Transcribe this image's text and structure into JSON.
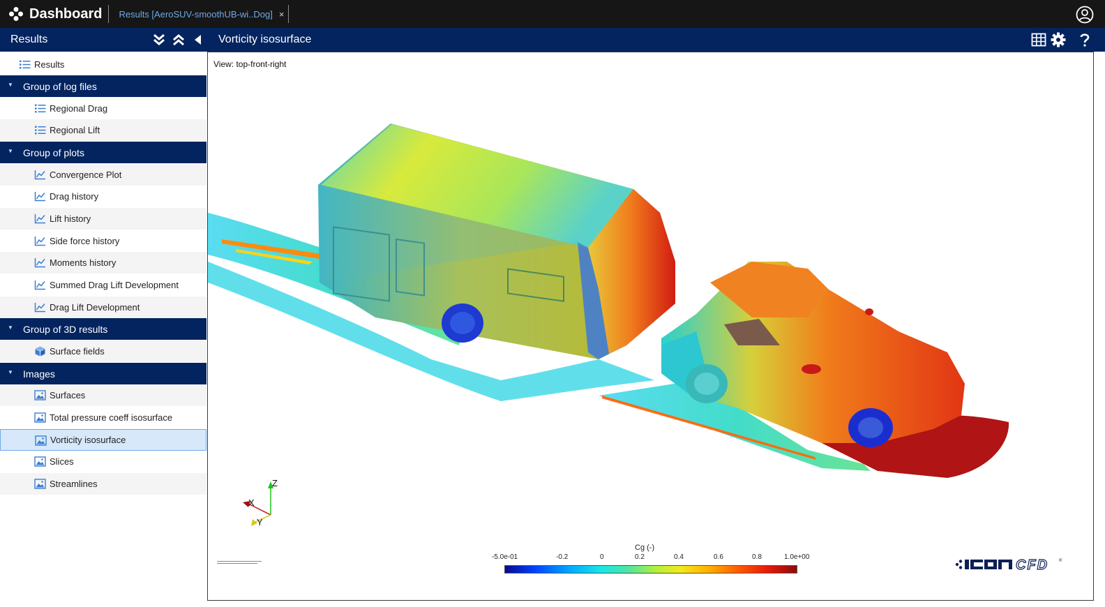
{
  "app": {
    "title": "Dashboard",
    "tab_label": "Results [AeroSUV-smoothUB-wi..Dog]",
    "tab_close": "×"
  },
  "panel": {
    "title": "Results"
  },
  "view": {
    "title": "Vorticity isosurface",
    "label": "View: top-front-right"
  },
  "sidebar": {
    "root_label": "Results",
    "groups": [
      {
        "label": "Group of log files",
        "caret": "▼"
      },
      {
        "label": "Group of plots",
        "caret": "▼"
      },
      {
        "label": "Group of 3D results",
        "caret": "▼"
      },
      {
        "label": "Images",
        "caret": "▼"
      }
    ],
    "log_items": [
      "Regional Drag",
      "Regional Lift"
    ],
    "plot_items": [
      "Convergence Plot",
      "Drag history",
      "Lift history",
      "Side force history",
      "Moments history",
      "Summed Drag Lift Development",
      "Drag Lift Development"
    ],
    "result_items": [
      "Surface fields"
    ],
    "image_items": [
      "Surfaces",
      "Total pressure coeff isosurface",
      "Vorticity isosurface",
      "Slices",
      "Streamlines"
    ],
    "selected": "Vorticity isosurface"
  },
  "colorbar": {
    "title": "Cg (-)",
    "ticks": [
      "-5.0e-01",
      "-0.2",
      "0",
      "0.2",
      "0.4",
      "0.6",
      "0.8",
      "1.0e+00"
    ],
    "min": -0.5,
    "max": 1.0
  },
  "axes": {
    "x": "X",
    "y": "Y",
    "z": "Z"
  },
  "colors": {
    "topbar": "#161616",
    "header": "#03245e",
    "accent": "#6ea9e8",
    "selected_bg": "#d6e8fa"
  }
}
